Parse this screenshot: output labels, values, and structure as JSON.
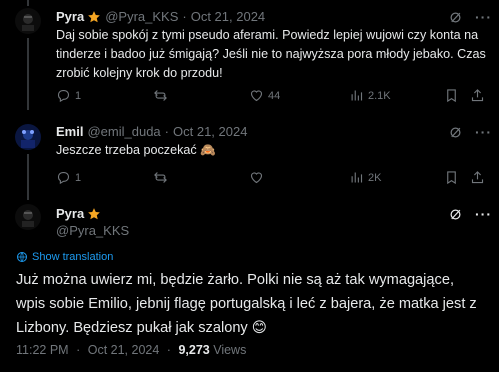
{
  "tweets": [
    {
      "name": "Pyra",
      "verified_badge": "star-badge",
      "handle": "@Pyra_KKS",
      "date": "Oct 21, 2024",
      "text": "Daj sobie spokój z tymi pseudo aferami. Powiedz lepiej wujowi czy konta na tinderze i badoo już śmigają? Jeśli nie to najwyższa pora młody jebako. Czas zrobić kolejny krok do przodu!",
      "replies": "1",
      "reposts": "",
      "likes": "44",
      "views": "2.1K"
    },
    {
      "name": "Emil",
      "handle": "@emil_duda",
      "date": "Oct 21, 2024",
      "text": "Jeszcze trzeba poczekać 🙈",
      "replies": "1",
      "reposts": "",
      "likes": "",
      "views": "2K"
    }
  ],
  "main": {
    "name": "Pyra",
    "handle": "@Pyra_KKS",
    "show_translation": "Show translation",
    "text": "Już można uwierz mi, będzie żarło. Polki nie są aż tak wymagające, wpis sobie Emilio, jebnij flagę portugalską i leć z bajera, że matka jest z Lizbony. Będziesz pukał jak szalony 😊",
    "time": "11:22 PM",
    "date": "Oct 21, 2024",
    "views_count": "9,273",
    "views_label": "Views"
  },
  "separator": "·",
  "colors": {
    "background": "#000000",
    "text": "#e7e9ea",
    "muted": "#71767b",
    "link": "#1d9bf0",
    "badge": "#f5a623"
  }
}
